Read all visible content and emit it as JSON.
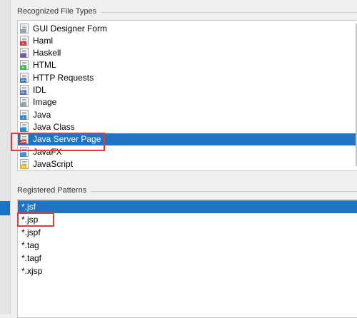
{
  "recognized": {
    "title": "Recognized File Types",
    "items": [
      {
        "label": "GUI Designer Form",
        "icon": "form-file-icon",
        "color": "#9aa3ad",
        "tag": ""
      },
      {
        "label": "Haml",
        "icon": "haml-file-icon",
        "color": "#d23c3c",
        "tag": "h"
      },
      {
        "label": "Haskell",
        "icon": "haskell-file-icon",
        "color": "#7b5ea7",
        "tag": ""
      },
      {
        "label": "HTML",
        "icon": "html-file-icon",
        "color": "#4caf50",
        "tag": "H"
      },
      {
        "label": "HTTP Requests",
        "icon": "http-file-icon",
        "color": "#2f6db6",
        "tag": "API"
      },
      {
        "label": "IDL",
        "icon": "idl-file-icon",
        "color": "#5560b8",
        "tag": "IDL"
      },
      {
        "label": "Image",
        "icon": "image-file-icon",
        "color": "#9aa3ad",
        "tag": ""
      },
      {
        "label": "Java",
        "icon": "java-file-icon",
        "color": "#2b8bd0",
        "tag": "J"
      },
      {
        "label": "Java Class",
        "icon": "java-class-file-icon",
        "color": "#2b8bd0",
        "tag": ""
      },
      {
        "label": "Java Server Page",
        "icon": "jsp-file-icon",
        "color": "#c0392b",
        "tag": "JSP"
      },
      {
        "label": "JavaFX",
        "icon": "javafx-file-icon",
        "color": "#4a90d9",
        "tag": ""
      },
      {
        "label": "JavaScript",
        "icon": "javascript-file-icon",
        "color": "#e0b526",
        "tag": "JS"
      }
    ],
    "selected_index": 9
  },
  "patterns": {
    "title": "Registered Patterns",
    "items": [
      "*.jsf",
      "*.jsp",
      "*.jspf",
      "*.tag",
      "*.tagf",
      "*.xjsp"
    ],
    "selected_index": 0
  },
  "colors": {
    "selection": "#1f74c4",
    "highlight": "#e53935"
  }
}
